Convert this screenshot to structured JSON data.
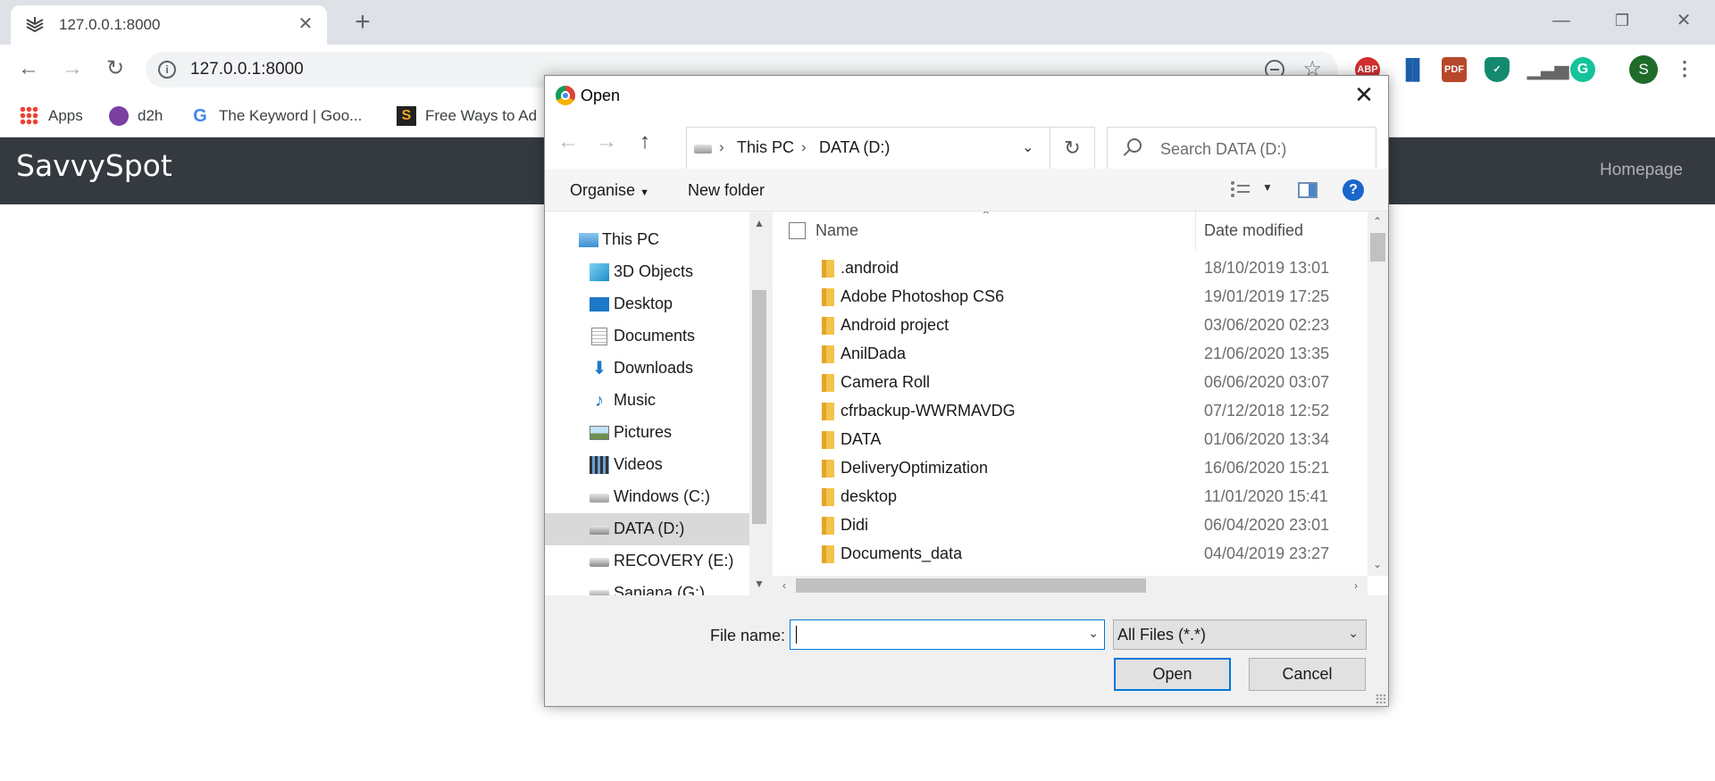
{
  "browser": {
    "tab_title": "127.0.0.1:8000",
    "url": "127.0.0.1:8000",
    "profile_initial": "S",
    "bookmarks": [
      {
        "label": "Apps",
        "icon": "apps-grid-icon"
      },
      {
        "label": "d2h",
        "icon": "d2h-icon"
      },
      {
        "label": "The Keyword | Goo...",
        "icon": "google-icon"
      },
      {
        "label": "Free Ways to Ad",
        "icon": "s-logo-icon"
      }
    ],
    "extensions": [
      "adblock-plus-icon",
      "bar-chart-extension-icon",
      "pdf-extension-icon",
      "shield-extension-icon",
      "analytics-extension-icon",
      "grammarly-icon"
    ]
  },
  "page": {
    "brand": "SavvySpot",
    "nav_link": "Homepage",
    "nav_bg": "#343a40"
  },
  "dialog": {
    "title": "Open",
    "path": [
      "This PC",
      "DATA (D:)"
    ],
    "search_placeholder": "Search DATA (D:)",
    "organise_label": "Organise",
    "new_folder_label": "New folder",
    "nav_items": [
      {
        "label": "This PC",
        "icon": "computer-icon"
      },
      {
        "label": "3D Objects",
        "icon": "3d-objects-icon"
      },
      {
        "label": "Desktop",
        "icon": "desktop-icon"
      },
      {
        "label": "Documents",
        "icon": "documents-icon"
      },
      {
        "label": "Downloads",
        "icon": "download-icon"
      },
      {
        "label": "Music",
        "icon": "music-icon"
      },
      {
        "label": "Pictures",
        "icon": "pictures-icon"
      },
      {
        "label": "Videos",
        "icon": "videos-icon"
      },
      {
        "label": "Windows (C:)",
        "icon": "windows-drive-icon"
      },
      {
        "label": "DATA (D:)",
        "icon": "drive-icon",
        "selected": true
      },
      {
        "label": "RECOVERY (E:)",
        "icon": "drive-icon"
      },
      {
        "label": "Sanjana (G:)",
        "icon": "drive-icon"
      }
    ],
    "columns": {
      "name": "Name",
      "date_modified": "Date modified"
    },
    "files": [
      {
        "name": ".android",
        "date": "18/10/2019 13:01"
      },
      {
        "name": "Adobe Photoshop CS6",
        "date": "19/01/2019 17:25"
      },
      {
        "name": "Android project",
        "date": "03/06/2020 02:23"
      },
      {
        "name": "AnilDada",
        "date": "21/06/2020 13:35"
      },
      {
        "name": "Camera Roll",
        "date": "06/06/2020 03:07"
      },
      {
        "name": "cfrbackup-WWRMAVDG",
        "date": "07/12/2018 12:52"
      },
      {
        "name": "DATA",
        "date": "01/06/2020 13:34"
      },
      {
        "name": "DeliveryOptimization",
        "date": "16/06/2020 15:21"
      },
      {
        "name": "desktop",
        "date": "11/01/2020 15:41"
      },
      {
        "name": "Didi",
        "date": "06/04/2020 23:01"
      },
      {
        "name": "Documents_data",
        "date": "04/04/2019 23:27"
      }
    ],
    "file_name_label": "File name:",
    "file_name_value": "",
    "file_type": "All Files (*.*)",
    "open_label": "Open",
    "cancel_label": "Cancel"
  }
}
